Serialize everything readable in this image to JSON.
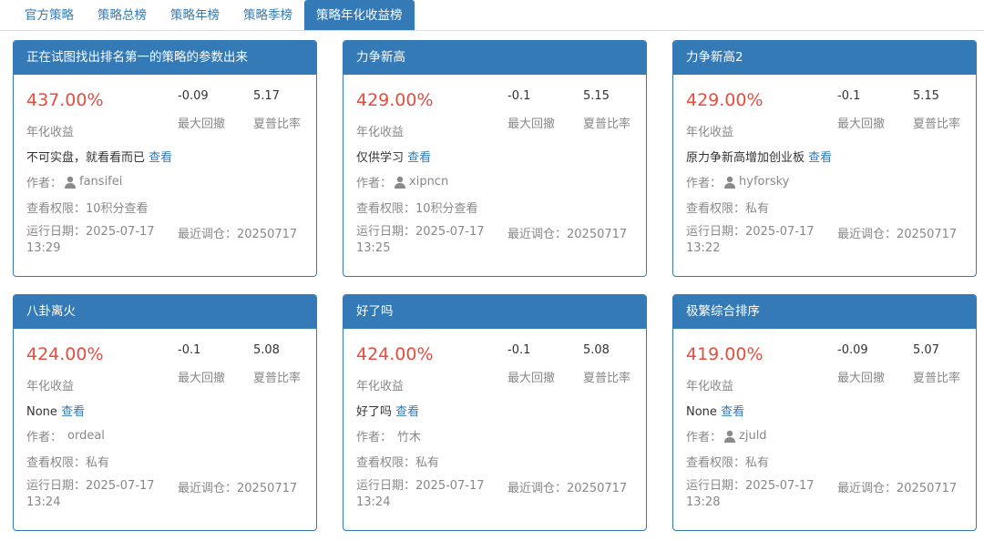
{
  "tabs": [
    {
      "label": "官方策略",
      "active": false
    },
    {
      "label": "策略总榜",
      "active": false
    },
    {
      "label": "策略年榜",
      "active": false
    },
    {
      "label": "策略季榜",
      "active": false
    },
    {
      "label": "策略年化收益榜",
      "active": true
    }
  ],
  "labels": {
    "annual_return": "年化收益",
    "max_drawdown": "最大回撤",
    "sharpe": "夏普比率",
    "view": "查看",
    "author_prefix": "作者：",
    "permission_prefix": "查看权限：",
    "run_date_prefix": "运行日期：",
    "last_rebalance_prefix": "最近调仓："
  },
  "colors": {
    "primary": "#337ab7",
    "return_red": "#e84c3d"
  },
  "cards": [
    {
      "title": "正在试图找出排名第一的策略的参数出来",
      "annual_return": "437.00%",
      "max_drawdown": "-0.09",
      "sharpe": "5.17",
      "description": "不可实盘，就看看而已",
      "author": "fansifei",
      "author_icon": true,
      "permission": "10积分查看",
      "run_date": "2025-07-17",
      "run_time": "13:29",
      "last_rebalance": "20250717"
    },
    {
      "title": "力争新高",
      "annual_return": "429.00%",
      "max_drawdown": "-0.1",
      "sharpe": "5.15",
      "description": "仅供学习",
      "author": "xipncn",
      "author_icon": true,
      "permission": "10积分查看",
      "run_date": "2025-07-17",
      "run_time": "13:25",
      "last_rebalance": "20250717"
    },
    {
      "title": "力争新高2",
      "annual_return": "429.00%",
      "max_drawdown": "-0.1",
      "sharpe": "5.15",
      "description": "原力争新高增加创业板",
      "author": "hyforsky",
      "author_icon": true,
      "permission": "私有",
      "run_date": "2025-07-17",
      "run_time": "13:22",
      "last_rebalance": "20250717"
    },
    {
      "title": "八卦离火",
      "annual_return": "424.00%",
      "max_drawdown": "-0.1",
      "sharpe": "5.08",
      "description": "None",
      "author": "ordeal",
      "author_icon": false,
      "permission": "私有",
      "run_date": "2025-07-17",
      "run_time": "13:24",
      "last_rebalance": "20250717"
    },
    {
      "title": "好了吗",
      "annual_return": "424.00%",
      "max_drawdown": "-0.1",
      "sharpe": "5.08",
      "description": "好了吗",
      "author": "竹木",
      "author_icon": false,
      "permission": "私有",
      "run_date": "2025-07-17",
      "run_time": "13:24",
      "last_rebalance": "20250717"
    },
    {
      "title": "极繁综合排序",
      "annual_return": "419.00%",
      "max_drawdown": "-0.09",
      "sharpe": "5.07",
      "description": "None",
      "author": "zjuld",
      "author_icon": true,
      "permission": "私有",
      "run_date": "2025-07-17",
      "run_time": "13:28",
      "last_rebalance": "20250717"
    }
  ]
}
